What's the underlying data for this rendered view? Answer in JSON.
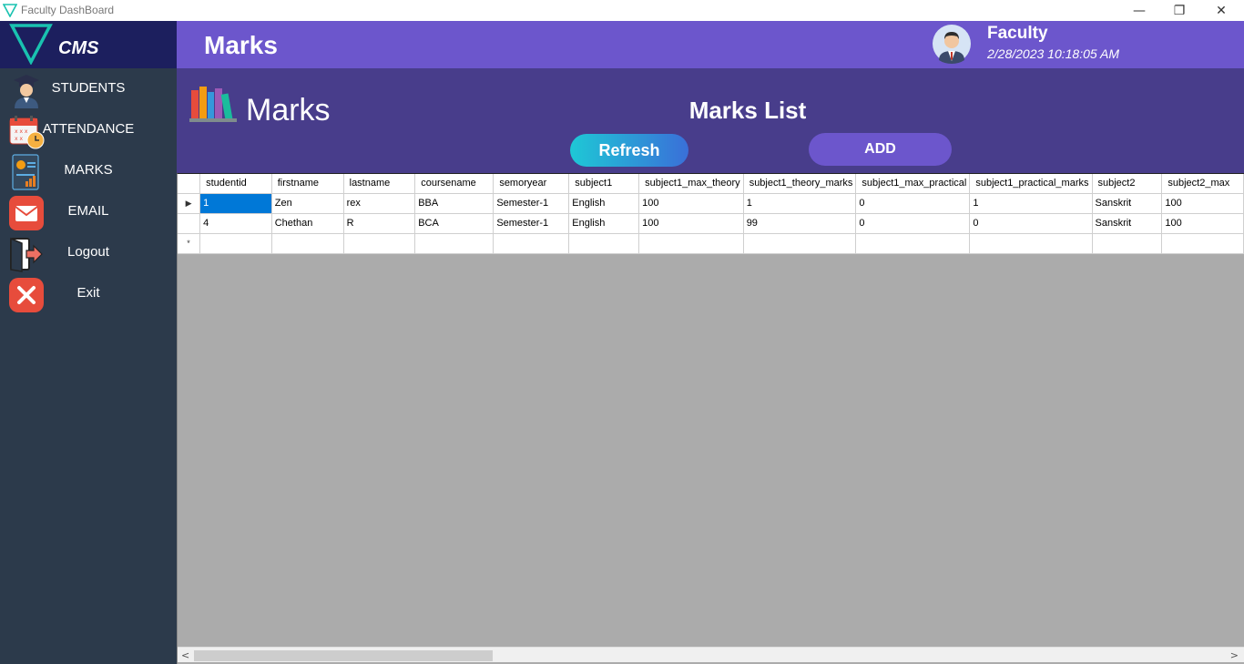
{
  "window": {
    "title": "Faculty DashBoard",
    "minimize": "—",
    "restore": "❐",
    "close": "✕"
  },
  "sidebar": {
    "logo_text": "CMS",
    "items": [
      {
        "label": "STUDENTS",
        "icon": "student-icon"
      },
      {
        "label": "ATTENDANCE",
        "icon": "calendar-icon"
      },
      {
        "label": "MARKS",
        "icon": "report-icon"
      },
      {
        "label": "EMAIL",
        "icon": "mail-icon"
      },
      {
        "label": "Logout",
        "icon": "logout-icon"
      },
      {
        "label": "Exit",
        "icon": "exit-icon"
      }
    ]
  },
  "header": {
    "title": "Marks",
    "user_name": "Faculty",
    "datetime": "2/28/2023 10:18:05 AM"
  },
  "banner": {
    "section_title": "Marks",
    "list_title": "Marks List",
    "refresh_label": "Refresh",
    "add_label": "ADD"
  },
  "grid": {
    "columns": [
      "studentid",
      "firstname",
      "lastname",
      "coursename",
      "semoryear",
      "subject1",
      "subject1_max_theory",
      "subject1_theory_marks",
      "subject1_max_practical",
      "subject1_practical_marks",
      "subject2",
      "subject2_max"
    ],
    "rows": [
      {
        "marker": "▶",
        "cells": [
          "1",
          "Zen",
          "rex",
          "BBA",
          "Semester-1",
          "English",
          "100",
          "1",
          "0",
          "1",
          "Sanskrit",
          "100"
        ]
      },
      {
        "marker": "",
        "cells": [
          "4",
          "Chethan",
          "R",
          "BCA",
          "Semester-1",
          "English",
          "100",
          "99",
          "0",
          "0",
          "Sanskrit",
          "100"
        ]
      },
      {
        "marker": "*",
        "cells": [
          "",
          "",
          "",
          "",
          "",
          "",
          "",
          "",
          "",
          "",
          "",
          ""
        ]
      }
    ],
    "scroll_left": "<",
    "scroll_right": ">"
  },
  "colors": {
    "sidebar": "#2c3a4b",
    "logo_bg": "#1c1f5e",
    "header": "#6c56cc",
    "banner": "#483d8b",
    "selection": "#0078d7",
    "grid_bg": "#ababab"
  }
}
